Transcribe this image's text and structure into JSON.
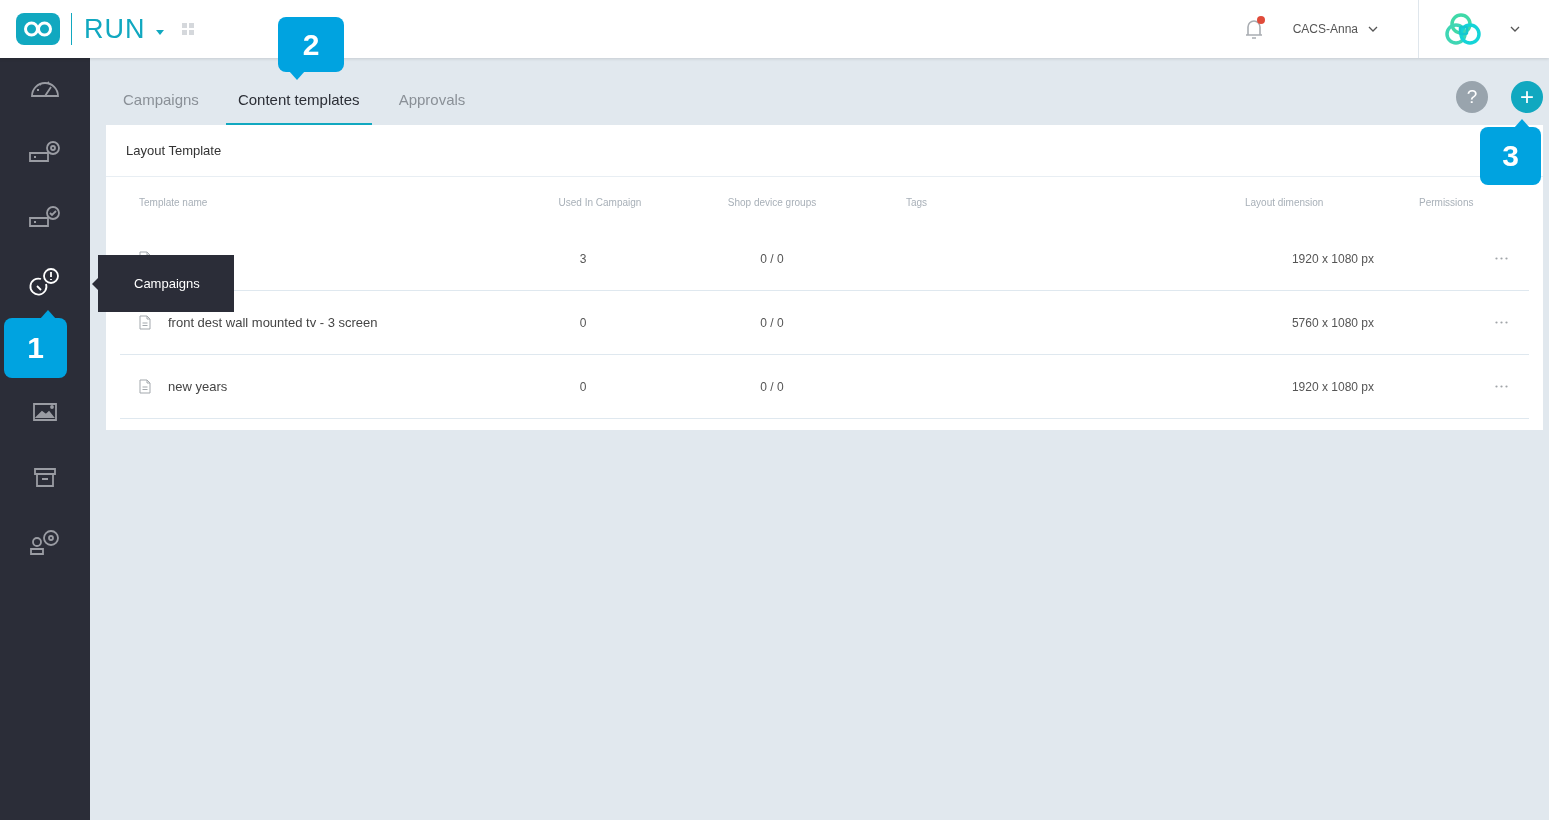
{
  "top_bar": {
    "app_name": "RUN",
    "notifications": {
      "unread": true
    },
    "user": "CACS-Anna"
  },
  "sidebar": {
    "items": [
      {
        "selected": false
      },
      {
        "selected": false
      },
      {
        "selected": false
      },
      {
        "selected": true
      },
      {
        "selected": false
      },
      {
        "selected": false
      },
      {
        "selected": false
      }
    ]
  },
  "tooltip": "Campaigns",
  "tabs": [
    {
      "label": "Campaigns",
      "selected": false
    },
    {
      "label": "Content templates",
      "selected": true
    },
    {
      "label": "Approvals",
      "selected": false
    }
  ],
  "actions": {
    "help": "?",
    "add": "+"
  },
  "card": {
    "title": "Layout Template",
    "columns": [
      "Template name",
      "Used In Campaign",
      "Shop device groups",
      "Tags",
      "Layout dimension",
      "Permissions"
    ],
    "rows": [
      {
        "used": "3",
        "groups": "0 / 0",
        "dimension": "1920 x 1080 px"
      },
      {
        "name": "front dest wall mounted tv - 3 screen",
        "used": "0",
        "groups": "0 / 0",
        "dimension": "5760 x 1080 px"
      },
      {
        "name": "new years",
        "used": "0",
        "groups": "0 / 0",
        "dimension": "1920 x 1080 px"
      }
    ]
  },
  "callouts": [
    {
      "number": "1"
    },
    {
      "number": "2"
    },
    {
      "number": "3"
    }
  ]
}
